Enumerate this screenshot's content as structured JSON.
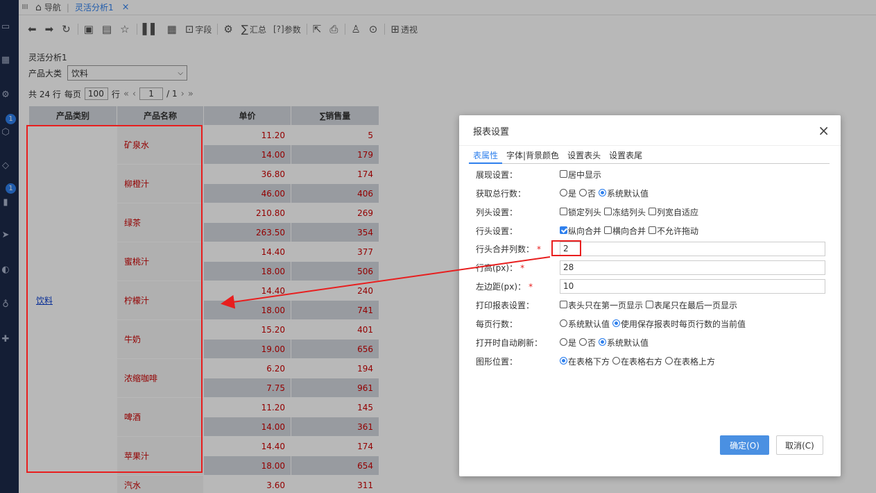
{
  "tabbar": {
    "menu": "III",
    "tabs": [
      {
        "label": "导航"
      },
      {
        "label": "灵活分析1"
      }
    ],
    "close": "×"
  },
  "rail": {
    "badges": [
      "1",
      "1"
    ]
  },
  "toolbar": {
    "field_label": "字段",
    "sum_label": "汇总",
    "param_label": "参数",
    "param_prefix": "[?]",
    "pivot_label": "透视"
  },
  "report": {
    "title": "灵活分析1",
    "filter_label": "产品大类",
    "filter_value": "饮料",
    "pager": {
      "total": "共 24 行",
      "per_page_label": "每页",
      "per_page": "100",
      "rows_label": "行",
      "page": "1",
      "pages": "/ 1"
    },
    "columns": [
      "产品类别",
      "产品名称",
      "单价",
      "∑销售量"
    ],
    "category": "饮料",
    "products": [
      "矿泉水",
      "柳橙汁",
      "绿茶",
      "蜜桃汁",
      "柠檬汁",
      "牛奶",
      "浓缩咖啡",
      "啤酒",
      "苹果汁",
      "汽水"
    ],
    "rows": [
      [
        "11.20",
        "5"
      ],
      [
        "14.00",
        "179"
      ],
      [
        "36.80",
        "174"
      ],
      [
        "46.00",
        "406"
      ],
      [
        "210.80",
        "269"
      ],
      [
        "263.50",
        "354"
      ],
      [
        "14.40",
        "377"
      ],
      [
        "18.00",
        "506"
      ],
      [
        "14.40",
        "240"
      ],
      [
        "18.00",
        "741"
      ],
      [
        "15.20",
        "401"
      ],
      [
        "19.00",
        "656"
      ],
      [
        "6.20",
        "194"
      ],
      [
        "7.75",
        "961"
      ],
      [
        "11.20",
        "145"
      ],
      [
        "14.00",
        "361"
      ],
      [
        "14.40",
        "174"
      ],
      [
        "18.00",
        "654"
      ],
      [
        "3.60",
        "311"
      ]
    ]
  },
  "dialog": {
    "title": "报表设置",
    "close": "×",
    "tabs": [
      "表属性",
      "字体|背景颜色",
      "设置表头",
      "设置表尾"
    ],
    "display_label": "展现设置：",
    "center": "居中显示",
    "total_label": "获取总行数：",
    "yes": "是",
    "no": "否",
    "sys_default": "系统默认值",
    "col_head_label": "列头设置：",
    "lock_col": "锁定列头",
    "freeze_col": "冻结列头",
    "auto_width": "列宽自适应",
    "row_head_label": "行头设置：",
    "v_merge": "纵向合并",
    "h_merge": "横向合并",
    "no_drag": "不允许拖动",
    "merge_cols_label": "行头合并列数：",
    "merge_cols_value": "2",
    "row_height_label": "行高(px)：",
    "row_height_value": "28",
    "left_margin_label": "左边距(px)：",
    "left_margin_value": "10",
    "print_label": "打印报表设置：",
    "print_head": "表头只在第一页显示",
    "print_tail": "表尾只在最后一页显示",
    "page_rows_label": "每页行数：",
    "page_rows_sys": "系统默认值",
    "page_rows_saved": "使用保存报表时每页行数的当前值",
    "refresh_label": "打开时自动刷新：",
    "chart_pos_label": "图形位置：",
    "below": "在表格下方",
    "right": "在表格右方",
    "above": "在表格上方",
    "required": "*",
    "ok": "确定(O)",
    "cancel": "取消(C)"
  },
  "colors": {
    "accent": "#2f80ed",
    "highlight": "#e81e1e",
    "header_bg": "#d3d7de",
    "rail": "#1d2a4a"
  }
}
